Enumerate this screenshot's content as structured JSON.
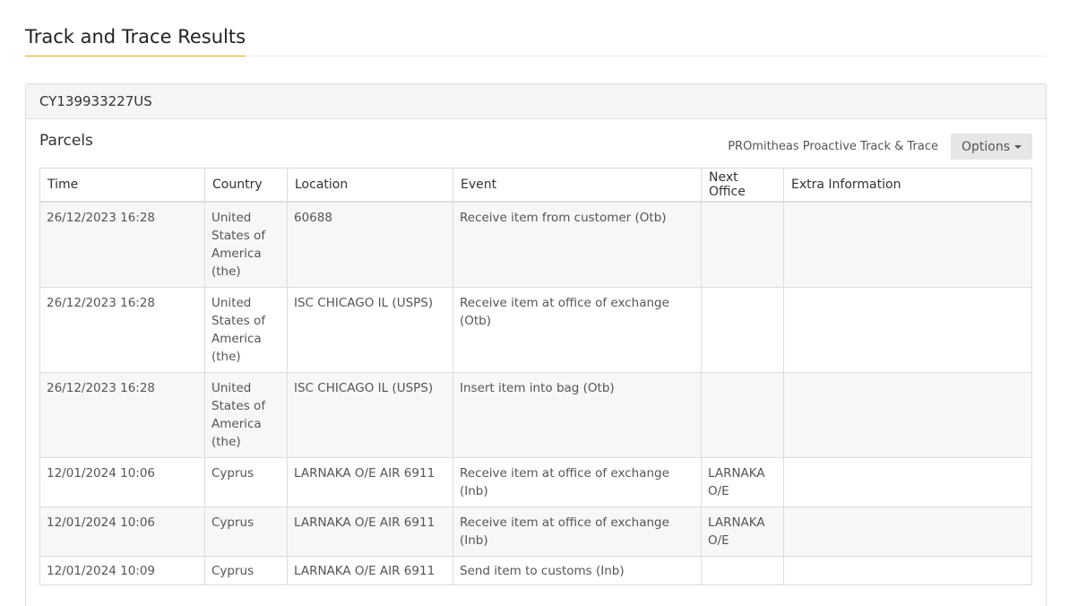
{
  "page": {
    "title": "Track and Trace Results"
  },
  "panel": {
    "tracking_number": "CY139933227US",
    "section_title": "Parcels",
    "link_label": "PROmitheas Proactive Track & Trace",
    "options_label": "Options",
    "options_icon": "caret-down-icon"
  },
  "table": {
    "headers": [
      "Time",
      "Country",
      "Location",
      "Event",
      "Next Office",
      "Extra Information"
    ],
    "rows": [
      {
        "time": "26/12/2023 16:28",
        "country": "United States of America (the)",
        "location": "60688",
        "event": "Receive item from customer (Otb)",
        "next_office": "",
        "extra": ""
      },
      {
        "time": "26/12/2023 16:28",
        "country": "United States of America (the)",
        "location": "ISC CHICAGO IL (USPS)",
        "event": "Receive item at office of exchange (Otb)",
        "next_office": "",
        "extra": ""
      },
      {
        "time": "26/12/2023 16:28",
        "country": "United States of America (the)",
        "location": "ISC CHICAGO IL (USPS)",
        "event": "Insert item into bag (Otb)",
        "next_office": "",
        "extra": ""
      },
      {
        "time": "12/01/2024 10:06",
        "country": "Cyprus",
        "location": "LARNAKA O/E AIR 6911",
        "event": "Receive item at office of exchange (Inb)",
        "next_office": "LARNAKA O/E",
        "extra": ""
      },
      {
        "time": "12/01/2024 10:06",
        "country": "Cyprus",
        "location": "LARNAKA O/E AIR 6911",
        "event": "Receive item at office of exchange (Inb)",
        "next_office": "LARNAKA O/E",
        "extra": ""
      },
      {
        "time": "12/01/2024 10:09",
        "country": "Cyprus",
        "location": "LARNAKA O/E AIR 6911",
        "event": "Send item to customs (Inb)",
        "next_office": "",
        "extra": ""
      }
    ]
  },
  "colors": {
    "title_underline": "#e0a82e",
    "panel_heading_bg": "#f5f5f5",
    "border": "#dddddd"
  }
}
